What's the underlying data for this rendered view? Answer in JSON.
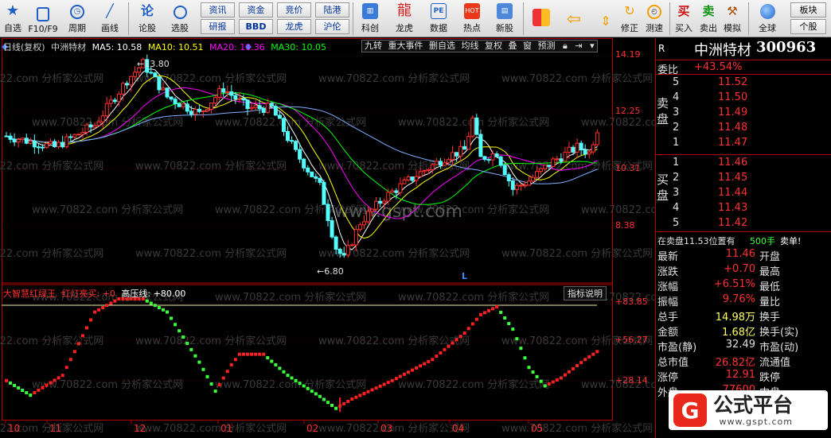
{
  "toolbar": {
    "buttons": [
      {
        "label": "自选",
        "icon": "star-icon"
      },
      {
        "label": "F10/F9",
        "icon": "document-icon"
      },
      {
        "label": "周期",
        "icon": "clock-icon"
      },
      {
        "label": "画线",
        "icon": "draw-line-icon"
      },
      {
        "label": "论股",
        "icon": "chat-icon"
      },
      {
        "label": "选股",
        "icon": "magnifier-icon"
      }
    ],
    "groups": [
      [
        "资讯",
        "研报"
      ],
      [
        "资金",
        "BBD"
      ],
      [
        "竞价",
        "龙虎"
      ],
      [
        "陆港",
        "沪伦"
      ]
    ],
    "buttons2": [
      {
        "label": "科创",
        "icon": "kechuang-icon"
      },
      {
        "label": "龙虎",
        "icon": "dragon-tiger-icon"
      },
      {
        "label": "数据",
        "icon": "pe-data-icon"
      },
      {
        "label": "热点",
        "icon": "fire-icon"
      },
      {
        "label": "新股",
        "icon": "new-stock-icon"
      }
    ],
    "buttons3": [
      {
        "label": "",
        "icon": "color-blocks-icon"
      },
      {
        "label": "",
        "icon": "back-arrow-icon"
      },
      {
        "label": "",
        "icon": "up-down-arrow-icon"
      },
      {
        "label": "修正",
        "icon": "revise-icon"
      },
      {
        "label": "测速",
        "icon": "timer-icon"
      },
      {
        "label": "买入",
        "icon": "buy-icon"
      },
      {
        "label": "卖出",
        "icon": "sell-icon"
      },
      {
        "label": "模拟",
        "icon": "hammer-icon"
      },
      {
        "label": "全球",
        "icon": "globe-icon"
      }
    ],
    "small": [
      "板块",
      "个股"
    ],
    "buy_glyph": "买",
    "sell_glyph": "卖",
    "pe_glyph": "PE"
  },
  "kline": {
    "period": "日线(复权)",
    "name": "中洲特材",
    "ma5": "MA5: 10.58",
    "ma10": "MA10: 10.51",
    "ma20": "MA20: 10.36",
    "ma30": "MA30: 10.05",
    "tools": [
      "九转",
      "重大事件",
      "删自选",
      "均线",
      "复权",
      "叠",
      "窗",
      "预测"
    ],
    "high_label": "13.80",
    "low_label": "6.80",
    "price_ticks": [
      "14.19",
      "12.25",
      "10.31",
      "8.38"
    ],
    "marker": "L"
  },
  "indicator": {
    "name": "大智慧红绿王",
    "line1": "红灯亮买: +0",
    "line2": "高压线: +80.00",
    "help": "指标说明",
    "ticks": [
      "+83.85",
      "+56.27",
      "+28.14"
    ]
  },
  "xaxis": [
    "10",
    "11",
    "12",
    "01",
    "02",
    "03",
    "04",
    "05"
  ],
  "watermarks": [
    "www.70822.com 分析家公式网",
    "www.gspt.com"
  ],
  "quote": {
    "r_label": "R",
    "name": "中洲特材",
    "code": "300963",
    "weibi_label": "委比",
    "weibi": "+43.54%",
    "sell_side": "卖盘",
    "buy_side": "买盘",
    "sell": [
      [
        "5",
        "11.52"
      ],
      [
        "4",
        "11.50"
      ],
      [
        "3",
        "11.49"
      ],
      [
        "2",
        "11.48"
      ],
      [
        "1",
        "11.47"
      ]
    ],
    "buy": [
      [
        "1",
        "11.46"
      ],
      [
        "2",
        "11.45"
      ],
      [
        "3",
        "11.44"
      ],
      [
        "4",
        "11.43"
      ],
      [
        "5",
        "11.42"
      ]
    ],
    "ticker": "在卖盘11.53位置有",
    "ticker_vol": "500手",
    "ticker_tag": "卖单!",
    "stats": [
      [
        "最新",
        "11.46",
        "开盘"
      ],
      [
        "涨跌",
        "+0.70",
        "最高"
      ],
      [
        "涨幅",
        "+6.51%",
        "最低"
      ],
      [
        "振幅",
        "9.76%",
        "量比"
      ],
      [
        "总手",
        "14.98万",
        "换手"
      ],
      [
        "金额",
        "1.68亿",
        "换手(实)"
      ],
      [
        "市盈(静)",
        "32.49",
        "市盈(动)"
      ],
      [
        "总市值",
        "26.82亿",
        "流通值"
      ],
      [
        "涨停",
        "12.91",
        "跌停"
      ],
      [
        "外盘",
        "77600",
        "内盘"
      ]
    ]
  },
  "logo": {
    "text": "公式平台",
    "url": "www.gspt.com"
  },
  "colors": {
    "up": "#ff3030",
    "down": "#54ffff",
    "ma5": "#ffffff",
    "ma10": "#ffff00",
    "ma20": "#ff00ff",
    "ma30": "#00ff00",
    "ma60": "#7fb0ff",
    "red": "#ff2020",
    "green": "#3cff3c"
  }
}
